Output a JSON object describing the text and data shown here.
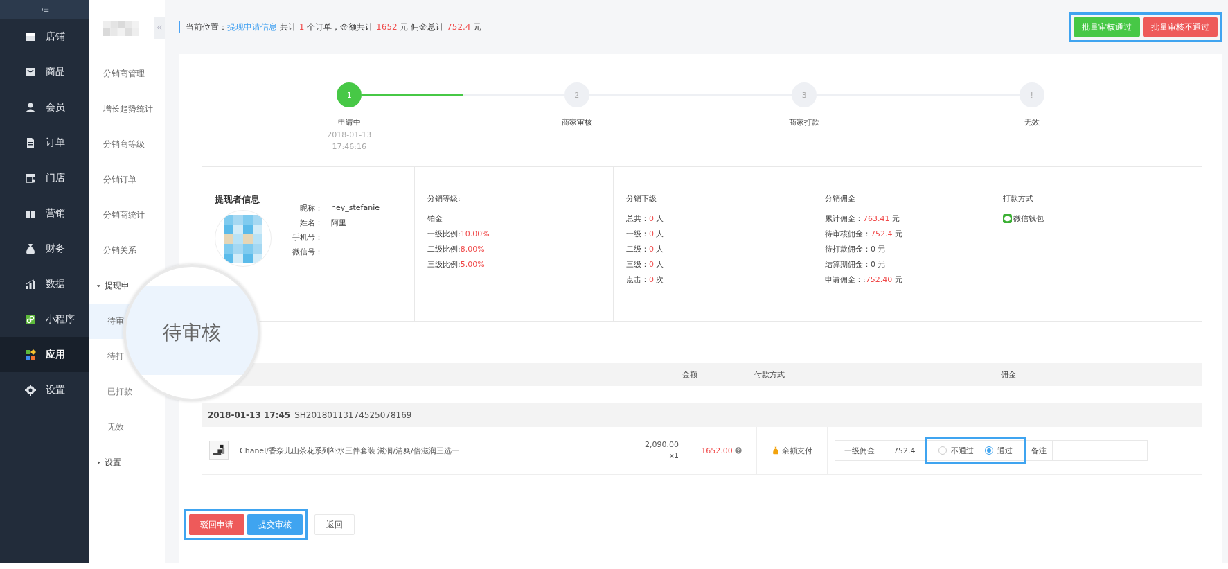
{
  "sidebar": {
    "items": [
      {
        "label": "店铺",
        "selected": false
      },
      {
        "label": "商品",
        "selected": false
      },
      {
        "label": "会员",
        "selected": false
      },
      {
        "label": "订单",
        "selected": false
      },
      {
        "label": "门店",
        "selected": false
      },
      {
        "label": "营销",
        "selected": false
      },
      {
        "label": "财务",
        "selected": false
      },
      {
        "label": "数据",
        "selected": false
      },
      {
        "label": "小程序",
        "selected": false
      },
      {
        "label": "应用",
        "selected": true
      },
      {
        "label": "设置",
        "selected": false
      }
    ]
  },
  "sub_sidebar": {
    "items": [
      {
        "label": "分销商管理",
        "selected": false
      },
      {
        "label": "增长趋势统计",
        "selected": false
      },
      {
        "label": "分销商等级",
        "selected": false
      },
      {
        "label": "分销订单",
        "selected": false
      },
      {
        "label": "分销商统计",
        "selected": false
      },
      {
        "label": "分销关系",
        "selected": false
      },
      {
        "label": "提现申",
        "expanded": true,
        "children": [
          {
            "label": "待审",
            "selected": true
          },
          {
            "label": "待打",
            "selected": false
          },
          {
            "label": "已打款",
            "selected": false
          },
          {
            "label": "无效",
            "selected": false
          }
        ]
      },
      {
        "label": "设置",
        "expanded": false
      }
    ]
  },
  "magnifier": {
    "text": "待审核"
  },
  "breadcrumb": {
    "label": "当前位置：",
    "link": "提现申请信息",
    "summary": [
      {
        "text": "共计 ",
        "highlight": false
      },
      {
        "text": "1",
        "highlight": true
      },
      {
        "text": " 个订单，金额共计 ",
        "highlight": false
      },
      {
        "text": "1652",
        "highlight": true
      },
      {
        "text": " 元 佣金总计 ",
        "highlight": false
      },
      {
        "text": "752.4",
        "highlight": true
      },
      {
        "text": " 元",
        "highlight": false
      }
    ]
  },
  "batch_actions": {
    "annotated": true,
    "buttons": [
      {
        "label": "批量审核通过",
        "kind": "approve"
      },
      {
        "label": "批量审核不通过",
        "kind": "reject"
      }
    ]
  },
  "steps": [
    {
      "number": "1",
      "label": "申请中",
      "date": "2018-01-13",
      "time": "17:46:16",
      "completed": true
    },
    {
      "number": "2",
      "label": "商家审核",
      "completed": false
    },
    {
      "number": "3",
      "label": "商家打款",
      "completed": false
    },
    {
      "number": "!",
      "label": "无效",
      "completed": false
    }
  ],
  "connectors": [
    {
      "level": 0.5
    },
    {
      "level": 0
    },
    {
      "level": 0
    }
  ],
  "withdrawer": {
    "title": "提现者信息",
    "fields": [
      {
        "label": "昵称：",
        "value": "hey_stefanie"
      },
      {
        "label": "姓名：",
        "value": "阿里"
      },
      {
        "label": "手机号："
      },
      {
        "label": "微信号："
      }
    ]
  },
  "info_columns": [
    {
      "title": "分销等级:",
      "lines": [
        {
          "label": "铂金"
        },
        {
          "label": "一级比例:",
          "value": "10.00%",
          "highlight": true
        },
        {
          "label": "二级比例:",
          "value": "8.00%",
          "highlight": true
        },
        {
          "label": "三级比例:",
          "value": "5.00%",
          "highlight": true
        }
      ]
    },
    {
      "title": "分销下级",
      "lines": [
        {
          "label": "总共：",
          "value": "0",
          "unit": "人",
          "highlight": true
        },
        {
          "label": "一级：",
          "value": "0",
          "unit": "人",
          "highlight": true
        },
        {
          "label": "二级：",
          "value": "0",
          "unit": "人",
          "highlight": true
        },
        {
          "label": "三级：",
          "value": "0",
          "unit": "人",
          "highlight": true
        },
        {
          "label": "点击：",
          "value": "0",
          "unit": "次",
          "highlight": true
        }
      ]
    },
    {
      "title": "分销佣金",
      "lines": [
        {
          "label": "累计佣金：",
          "value": "763.41",
          "unit": "元",
          "highlight": true
        },
        {
          "label": "待审核佣金：",
          "value": "752.4",
          "unit": "元",
          "highlight": true
        },
        {
          "label": "待打款佣金：",
          "value": "0",
          "unit": "元",
          "highlight": false
        },
        {
          "label": "结算期佣金：",
          "value": "0",
          "unit": "元",
          "highlight": false
        },
        {
          "label": "申请佣金：:",
          "value": "752.40",
          "unit": "元",
          "highlight": true
        }
      ]
    }
  ],
  "payment_method": {
    "title": "打款方式",
    "value": "微信钱包"
  },
  "table": {
    "columns": [
      {
        "label": "金额"
      },
      {
        "label": "付款方式"
      },
      {
        "label": "佣金"
      }
    ]
  },
  "order": {
    "date": "2018-01-13 17:45",
    "order_no": "SH20180113174525078169",
    "product": "Chanel/香奈儿山茶花系列补水三件套装 滋润/清爽/倍滋润三选一",
    "price": "2,090.00",
    "quantity": "x1",
    "amount": "1652.00",
    "payment": "余额支付",
    "commission_label": "一级佣金",
    "commission_value": "752.4",
    "review_annotated": true,
    "review_options": [
      {
        "label": "不通过",
        "selected": false
      },
      {
        "label": "通过",
        "selected": true
      }
    ],
    "remark_label": "备注"
  },
  "footer_actions": {
    "annotated": true,
    "buttons": [
      {
        "label": "驳回申请",
        "kind": "reject"
      },
      {
        "label": "提交审核",
        "kind": "primary"
      },
      {
        "label": "返回",
        "kind": "plain"
      }
    ]
  }
}
